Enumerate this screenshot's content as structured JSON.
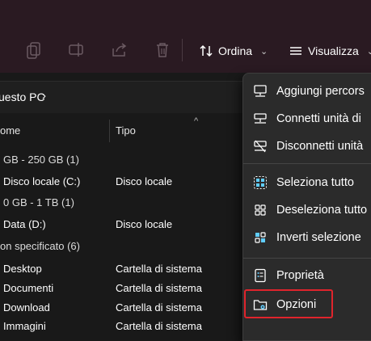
{
  "toolbar": {
    "sort_label": "Ordina",
    "view_label": "Visualizza"
  },
  "address": {
    "crumb": "uesto PC"
  },
  "columns": {
    "name": "ome",
    "type": "Tipo"
  },
  "groups": [
    {
      "label": "GB - 250 GB (1)"
    },
    {
      "label": "0 GB - 1 TB (1)"
    },
    {
      "label": "on specificato (6)"
    }
  ],
  "rows": [
    {
      "name": "Disco locale (C:)",
      "type": "Disco locale"
    },
    {
      "name": "Data (D:)",
      "type": "Disco locale"
    },
    {
      "name": "Desktop",
      "type": "Cartella di sistema"
    },
    {
      "name": "Documenti",
      "type": "Cartella di sistema"
    },
    {
      "name": "Download",
      "type": "Cartella di sistema"
    },
    {
      "name": "Immagini",
      "type": "Cartella di sistema"
    }
  ],
  "menu": {
    "items": [
      {
        "label": "Aggiungi percors",
        "icon": "add-network-location-icon"
      },
      {
        "label": "Connetti unità di",
        "icon": "map-network-drive-icon"
      },
      {
        "label": "Disconnetti unità",
        "icon": "disconnect-network-drive-icon"
      },
      {
        "label": "Seleziona tutto",
        "icon": "select-all-icon"
      },
      {
        "label": "Deseleziona tutto",
        "icon": "select-none-icon"
      },
      {
        "label": "Inverti selezione",
        "icon": "invert-selection-icon"
      },
      {
        "label": "Proprietà",
        "icon": "properties-icon"
      },
      {
        "label": "Opzioni",
        "icon": "folder-options-icon"
      }
    ]
  },
  "colors": {
    "accent": "#60cdff",
    "highlight": "#e0242c"
  }
}
